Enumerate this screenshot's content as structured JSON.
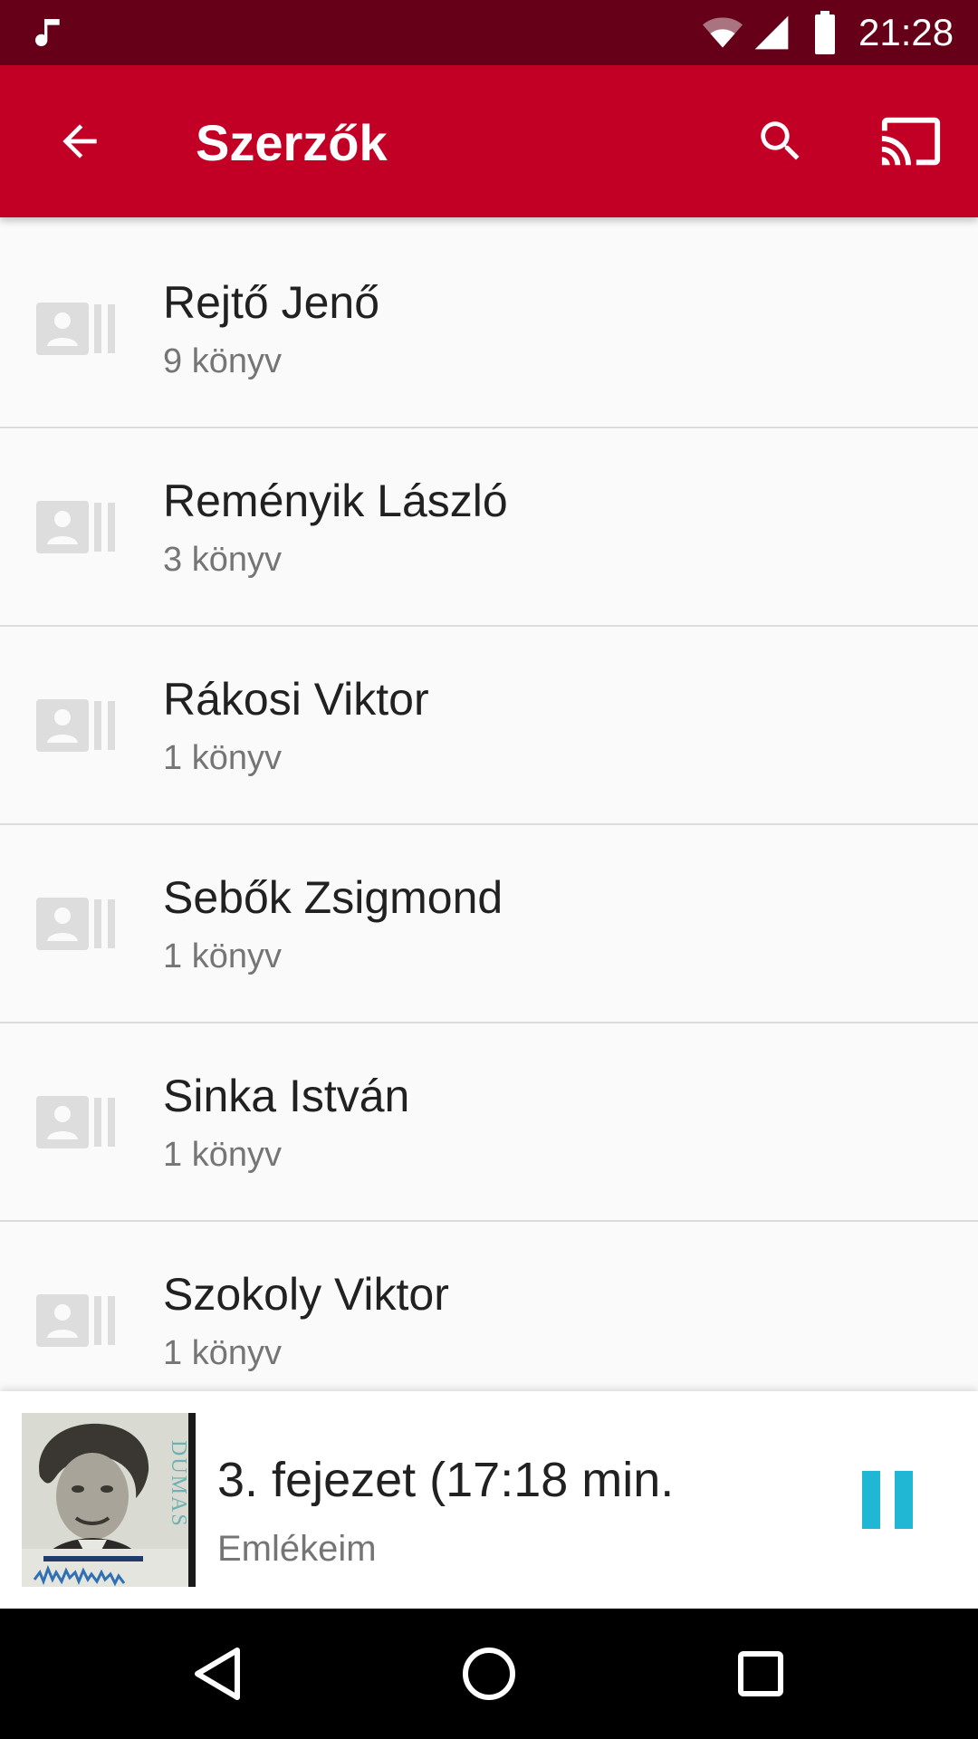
{
  "status_bar": {
    "time": "21:28",
    "icons": [
      "music-note-icon",
      "wifi-icon",
      "cell-signal-icon",
      "battery-icon"
    ]
  },
  "app_bar": {
    "title": "Szerzők",
    "icons": [
      "back-arrow-icon",
      "search-icon",
      "cast-icon"
    ]
  },
  "authors": [
    {
      "name": "Rejtő Jenő",
      "count": "9 könyv"
    },
    {
      "name": "Reményik László",
      "count": "3 könyv"
    },
    {
      "name": "Rákosi Viktor",
      "count": "1 könyv"
    },
    {
      "name": "Sebők Zsigmond",
      "count": "1 könyv"
    },
    {
      "name": "Sinka István",
      "count": "1 könyv"
    },
    {
      "name": "Szokoly Viktor",
      "count": "1 könyv"
    }
  ],
  "now_playing": {
    "title": "3. fejezet (17:18 min.",
    "subtitle": "Emlékeim",
    "cover_text": "DUMAS",
    "state_icon": "pause-icon"
  },
  "nav_bar": {
    "icons": [
      "nav-back-icon",
      "nav-home-icon",
      "nav-recents-icon"
    ]
  },
  "colors": {
    "status_bar": "#650018",
    "app_bar": "#c20025",
    "accent": "#1fb7d4",
    "list_background": "#fafafa"
  }
}
